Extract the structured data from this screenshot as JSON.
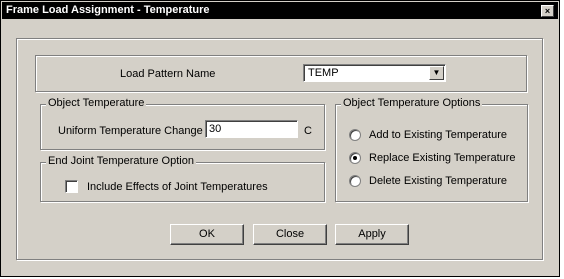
{
  "window": {
    "title": "Frame Load Assignment - Temperature",
    "close_glyph": "×"
  },
  "load_pattern": {
    "label": "Load Pattern Name",
    "selected": "TEMP"
  },
  "object_temperature": {
    "legend": "Object Temperature",
    "uniform_label": "Uniform Temperature Change",
    "uniform_value": "30",
    "unit": "C"
  },
  "end_joint": {
    "legend": "End Joint Temperature Option",
    "checkbox_label": "Include Effects of Joint Temperatures",
    "checked": false
  },
  "options": {
    "legend": "Object Temperature Options",
    "items": [
      {
        "label": "Add to Existing Temperature",
        "selected": false
      },
      {
        "label": "Replace Existing Temperature",
        "selected": true
      },
      {
        "label": "Delete Existing Temperature",
        "selected": false
      }
    ]
  },
  "buttons": {
    "ok": "OK",
    "close": "Close",
    "apply": "Apply"
  }
}
